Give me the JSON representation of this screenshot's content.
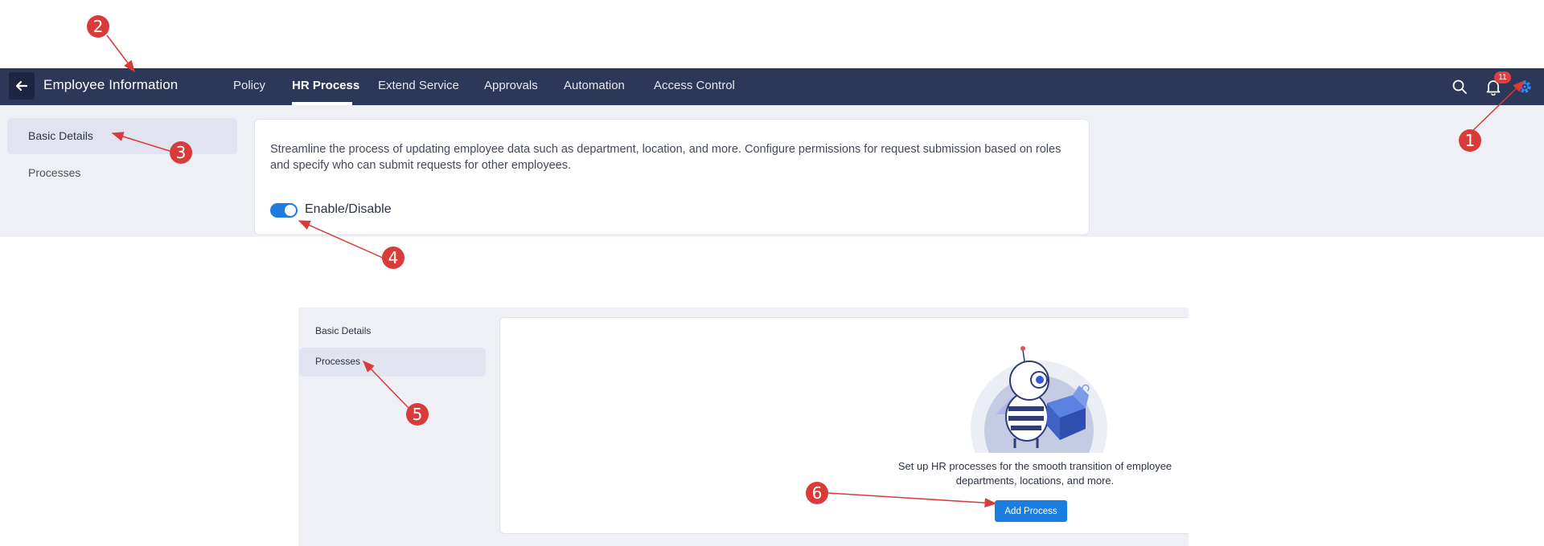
{
  "topbar": {
    "title": "Employee Information",
    "tabs": [
      {
        "label": "Policy",
        "active": false
      },
      {
        "label": "HR Process",
        "active": true
      },
      {
        "label": "Extend Service",
        "active": false
      },
      {
        "label": "Approvals",
        "active": false
      },
      {
        "label": "Automation",
        "active": false
      },
      {
        "label": "Access Control",
        "active": false
      }
    ],
    "notification_count": "11",
    "icons": [
      "back-arrow-icon",
      "search-icon",
      "bell-icon",
      "gear-icon"
    ]
  },
  "top_sidebar": {
    "items": [
      {
        "label": "Basic Details",
        "active": true
      },
      {
        "label": "Processes",
        "active": false
      }
    ]
  },
  "top_card": {
    "description": "Streamline the process of updating employee data such as department, location, and more. Configure permissions for request submission based on roles and specify who can submit requests for other employees.",
    "toggle_label": "Enable/Disable",
    "toggle_on": true
  },
  "bottom_sidebar": {
    "items": [
      {
        "label": "Basic Details",
        "active": false
      },
      {
        "label": "Processes",
        "active": true
      }
    ]
  },
  "bottom_card": {
    "empty_text": "Set up HR processes for the smooth transition of employee departments, locations, and more.",
    "add_button": "Add Process"
  },
  "callouts": [
    "1",
    "2",
    "3",
    "4",
    "5",
    "6"
  ],
  "colors": {
    "topbar_bg": "#2b3857",
    "accent": "#1a7de0",
    "callout_red": "#d93a3a",
    "content_bg": "#eef0f6"
  }
}
